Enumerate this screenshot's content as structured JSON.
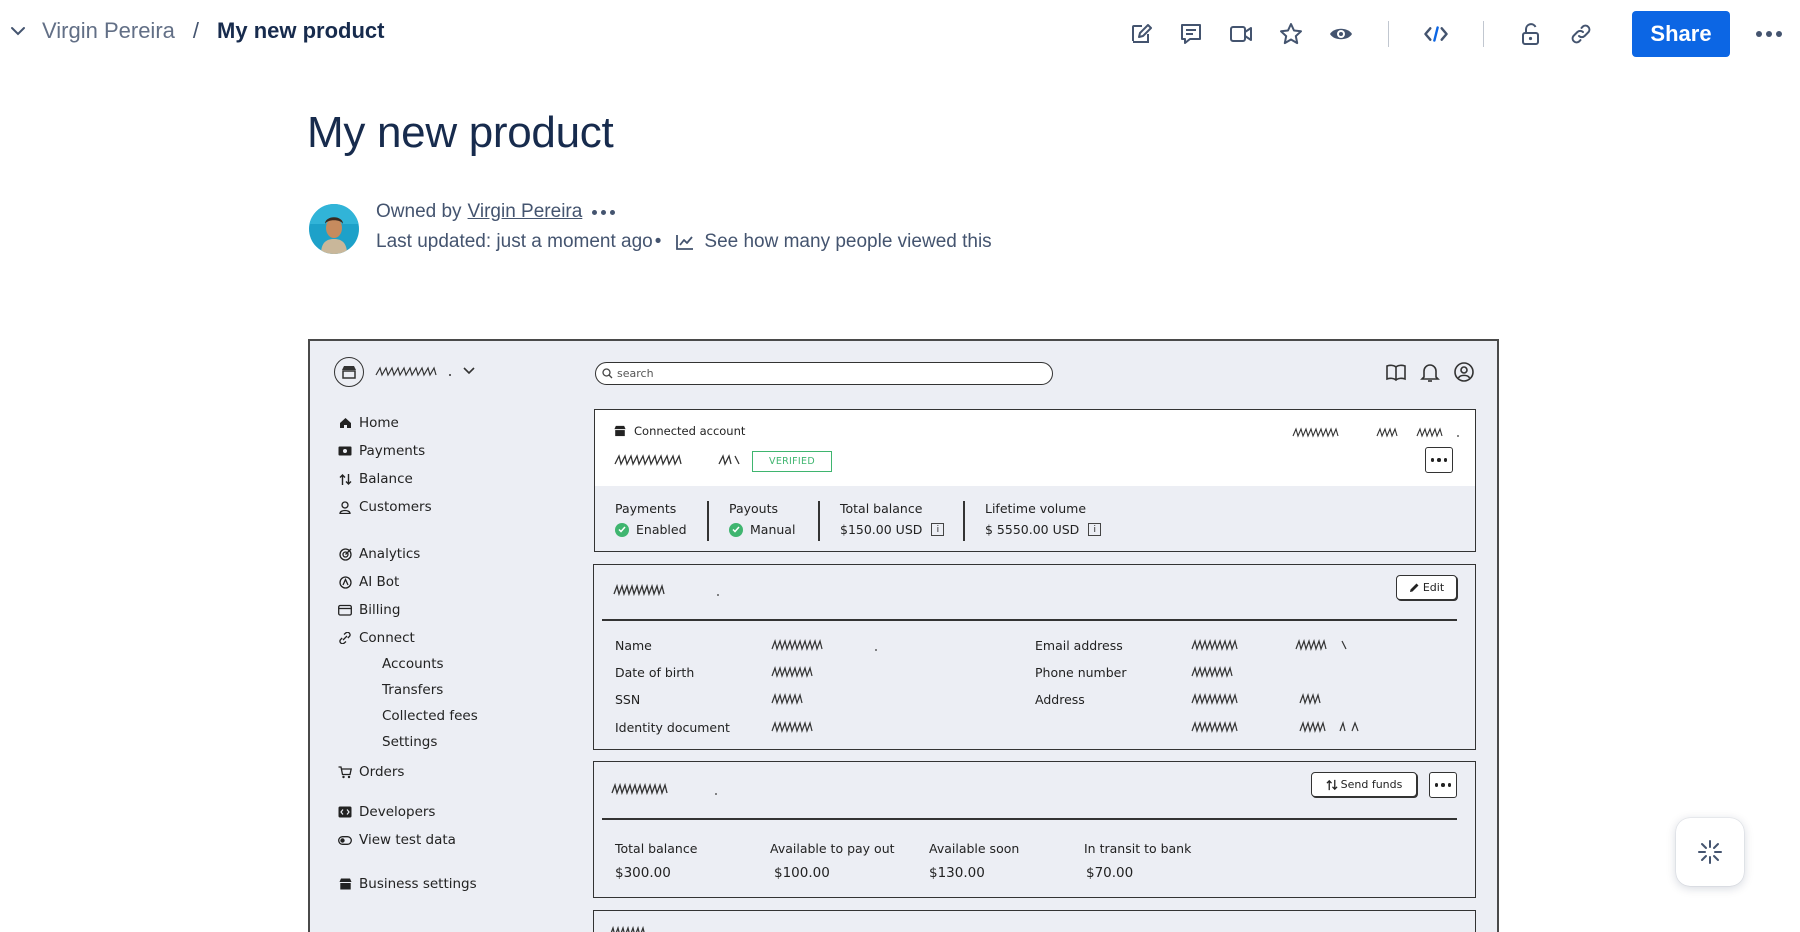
{
  "breadcrumb": {
    "parent": "Virgin Pereira",
    "separator": "/",
    "current": "My new product"
  },
  "toolbar": {
    "share_label": "Share",
    "icons": [
      "edit-icon",
      "comment-icon",
      "video-icon",
      "star-icon",
      "watch-icon",
      "code-icon",
      "unlock-icon",
      "link-icon",
      "more-icon"
    ]
  },
  "page": {
    "title": "My new product",
    "owned_by_prefix": "Owned by",
    "owner": "Virgin Pereira",
    "last_updated": "Last updated: just a moment ago",
    "bullet": "•",
    "views_link": "See how many people viewed this"
  },
  "wireframe": {
    "search_placeholder": "search",
    "nav": {
      "home": "Home",
      "payments": "Payments",
      "balance": "Balance",
      "customers": "Customers",
      "analytics": "Analytics",
      "ai_bot": "AI Bot",
      "billing": "Billing",
      "connect": "Connect",
      "accounts": "Accounts",
      "transfers": "Transfers",
      "collected_fees": "Collected fees",
      "settings": "Settings",
      "orders": "Orders",
      "developers": "Developers",
      "view_test_data": "View test data",
      "business_settings": "Business settings"
    },
    "account_card": {
      "title": "Connected account",
      "badge": "VERIFIED",
      "stats": {
        "payments_label": "Payments",
        "payments_value": "Enabled",
        "payouts_label": "Payouts",
        "payouts_value": "Manual",
        "total_balance_label": "Total balance",
        "total_balance_value": "$150.00 USD",
        "lifetime_label": "Lifetime volume",
        "lifetime_value": "$ 5550.00 USD",
        "info_glyph": "i"
      }
    },
    "details_card": {
      "edit_label": "Edit",
      "fields": {
        "name": "Name",
        "dob": "Date of birth",
        "ssn": "SSN",
        "identity": "Identity document",
        "email": "Email address",
        "phone": "Phone number",
        "address": "Address"
      }
    },
    "balance_card": {
      "send_funds_label": "Send funds",
      "total_balance_label": "Total balance",
      "total_balance_value": "$300.00",
      "available_label": "Available to pay out",
      "available_value": "$100.00",
      "soon_label": "Available soon",
      "soon_value": "$130.00",
      "transit_label": "In transit to bank",
      "transit_value": "$70.00"
    }
  },
  "colors": {
    "share_blue": "#0c66e4",
    "verified_green": "#3fb56f",
    "wireframe_bg": "#eceef4"
  }
}
